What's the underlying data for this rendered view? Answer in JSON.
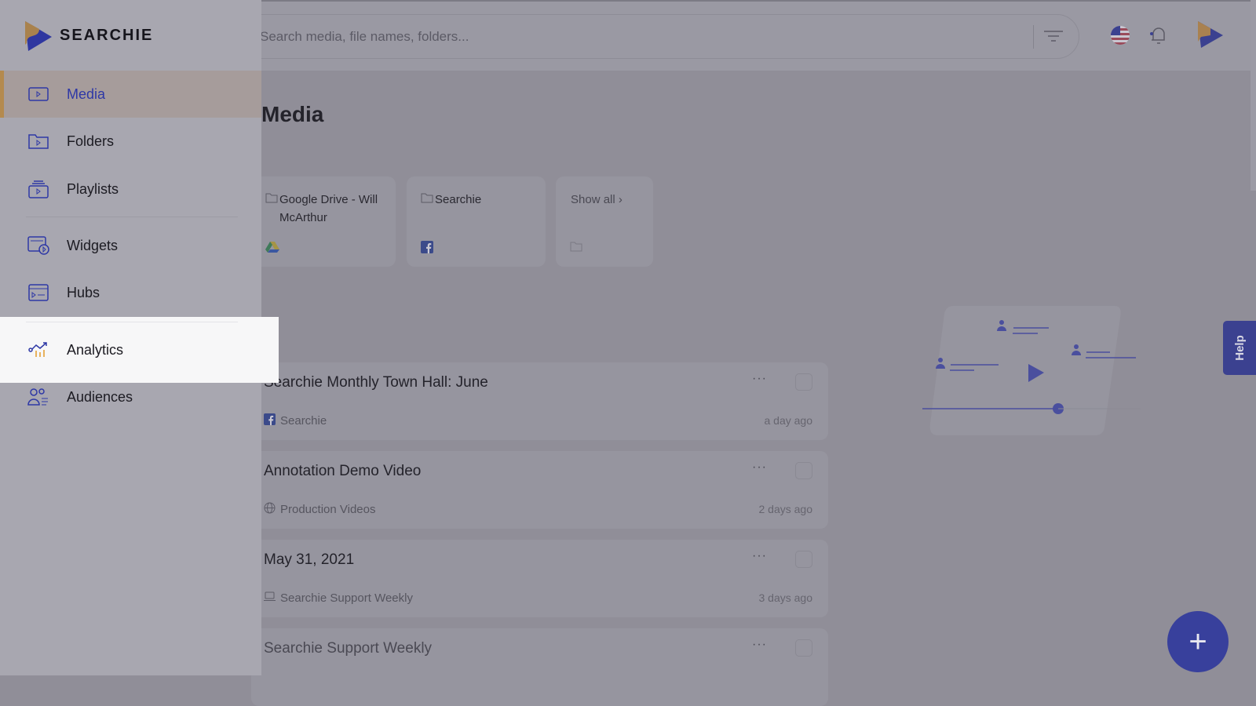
{
  "brand": {
    "name": "SEARCHIE",
    "accent": "#2e38a6",
    "secondary": "#b48a4e"
  },
  "search": {
    "placeholder": "Search media, file names, folders..."
  },
  "sidebar": {
    "items": [
      {
        "label": "Media",
        "icon": "media-icon",
        "active": true
      },
      {
        "label": "Folders",
        "icon": "folder-icon"
      },
      {
        "label": "Playlists",
        "icon": "playlist-icon"
      },
      {
        "label": "Widgets",
        "icon": "widget-icon"
      },
      {
        "label": "Hubs",
        "icon": "hub-icon"
      },
      {
        "label": "Analytics",
        "icon": "analytics-icon",
        "highlighted": true
      },
      {
        "label": "Audiences",
        "icon": "audiences-icon"
      }
    ]
  },
  "main": {
    "title": "Media",
    "folders": [
      {
        "name": "Google Drive - Will McArthur",
        "source": "google-drive-icon"
      },
      {
        "name": "Searchie",
        "source": "facebook-icon"
      },
      {
        "name": "Show all ›",
        "source": "folder-icon"
      }
    ],
    "media": [
      {
        "title": "Searchie Monthly Town Hall: June",
        "source": "Searchie",
        "source_icon": "facebook-icon",
        "when": "a day ago"
      },
      {
        "title": "Annotation Demo Video",
        "source": "Production Videos",
        "source_icon": "globe-icon",
        "when": "2 days ago"
      },
      {
        "title": "May 31, 2021",
        "source": "Searchie Support Weekly",
        "source_icon": "laptop-icon",
        "when": "3 days ago"
      },
      {
        "title": "Searchie Support Weekly",
        "source": "",
        "when": ""
      }
    ],
    "more_label": "···"
  },
  "help_label": "Help",
  "fab_label": "+"
}
